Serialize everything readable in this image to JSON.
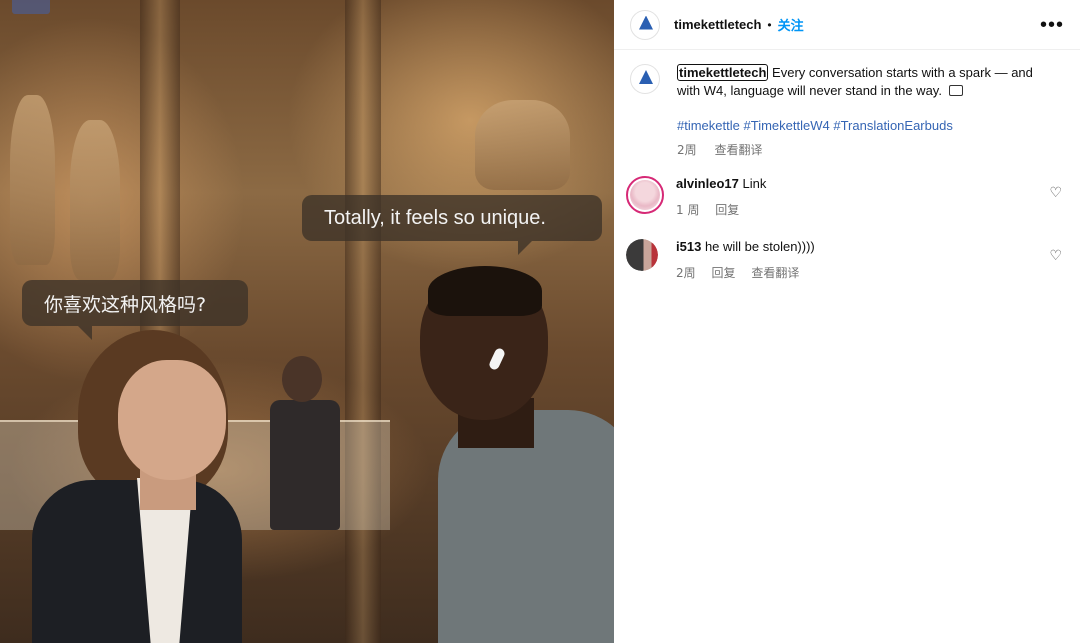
{
  "photo": {
    "bubble_en": "Totally, it feels so unique.",
    "bubble_zh": "你喜欢这种风格吗?"
  },
  "header": {
    "username": "timekettletech",
    "separator": "•",
    "follow_label": "关注",
    "more_icon": "more-horizontal-icon"
  },
  "post": {
    "username": "timekettletech",
    "caption": "Every conversation starts with a spark — and with W4, language will never stand in the way.",
    "hashtags": [
      "#timekettle",
      "#TimekettleW4",
      "#TranslationEarbuds"
    ],
    "time": "2周",
    "translate": "查看翻译"
  },
  "comments": [
    {
      "username": "alvinleo17",
      "text": "Link",
      "time": "1 周",
      "reply": "回复",
      "translate": ""
    },
    {
      "username": "i513",
      "text": "he will be stolen))))",
      "time": "2周",
      "reply": "回复",
      "translate": "查看翻译"
    }
  ]
}
